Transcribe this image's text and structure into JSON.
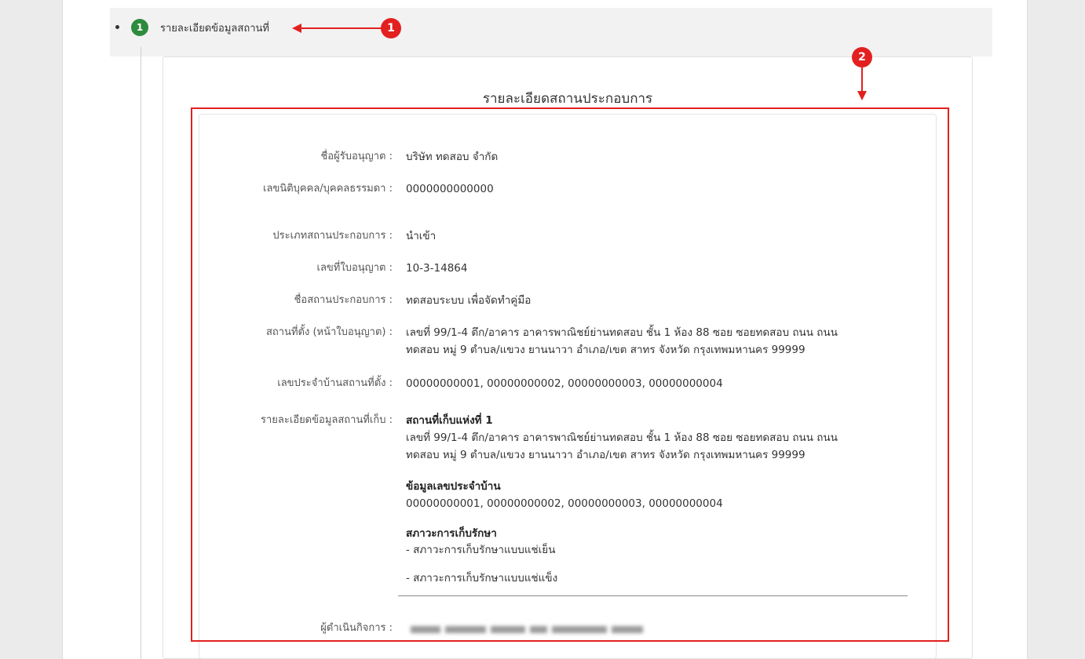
{
  "section": {
    "step_number": "1",
    "label": "รายละเอียดข้อมูลสถานที่"
  },
  "annotations": {
    "badge1": "1",
    "badge2": "2"
  },
  "card": {
    "title": "รายละเอียดสถานประกอบการ"
  },
  "details": {
    "licensee_label": "ชื่อผู้รับอนุญาต :",
    "licensee_value": "บริษัท ทดสอบ จำกัด",
    "id_label": "เลขนิติบุคคล/บุคคลธรรมดา :",
    "id_value": "0000000000000",
    "type_label": "ประเภทสถานประกอบการ :",
    "type_value": "นำเข้า",
    "license_no_label": "เลขที่ใบอนุญาต :",
    "license_no_value": "10-3-14864",
    "name_label": "ชื่อสถานประกอบการ :",
    "name_value": "ทดสอบระบบ เพื่อจัดทำคู่มือ",
    "location_label": "สถานที่ตั้ง (หน้าใบอนุญาต) :",
    "location_value_line1": "เลขที่ 99/1-4 ตึก/อาคาร อาคารพาณิชย์ย่านทดสอบ ชั้น 1 ห้อง 88 ซอย ซอยทดสอบ ถนน ถนน",
    "location_value_line2": "ทดสอบ หมู่ 9 ตำบล/แขวง ยานนาวา อำเภอ/เขต สาทร จังหวัด กรุงเทพมหานคร 99999",
    "house_no_label": "เลขประจำบ้านสถานที่ตั้ง :",
    "house_no_value": "00000000001, 00000000002, 00000000003, 00000000004",
    "storage_label": "รายละเอียดข้อมูลสถานที่เก็บ :",
    "storage_heading": "สถานที่เก็บแห่งที่ 1",
    "storage_addr_line1": "เลขที่ 99/1-4 ตึก/อาคาร อาคารพาณิชย์ย่านทดสอบ ชั้น 1 ห้อง 88 ซอย ซอยทดสอบ ถนน ถนน",
    "storage_addr_line2": "ทดสอบ หมู่ 9 ตำบล/แขวง ยานนาวา อำเภอ/เขต สาทร จังหวัด กรุงเทพมหานคร 99999",
    "storage_house_heading": "ข้อมูลเลขประจำบ้าน",
    "storage_house_value": "00000000001, 00000000002, 00000000003, 00000000004",
    "storage_cond_heading": "สภาวะการเก็บรักษา",
    "storage_cond_1": "- สภาวะการเก็บรักษาแบบแช่เย็น",
    "storage_cond_2": "- สภาวะการเก็บรักษาแบบแช่แข็ง",
    "operator_label": "ผู้ดำเนินกิจการ :"
  }
}
